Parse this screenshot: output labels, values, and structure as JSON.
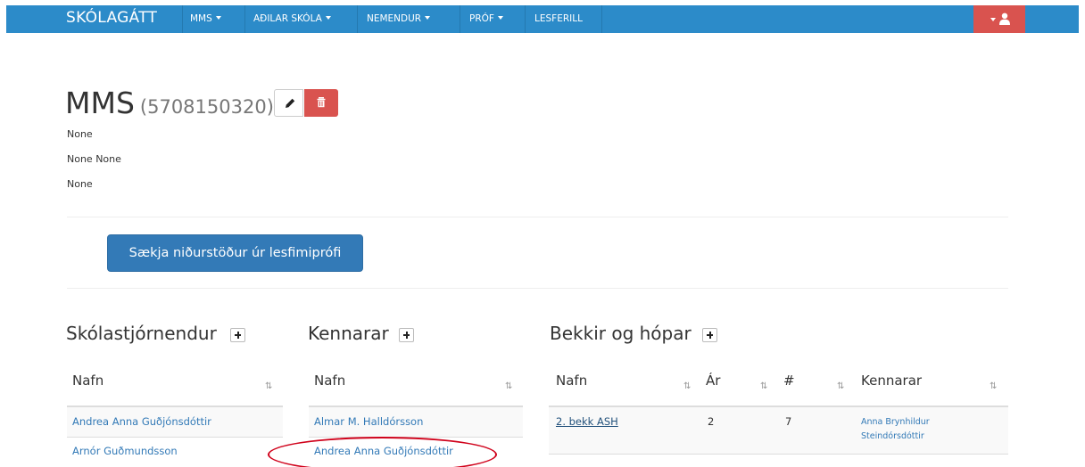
{
  "navbar": {
    "brand": "SKÓLAGÁTT",
    "items": [
      {
        "label": "MMS",
        "dropdown": true
      },
      {
        "label": "AÐILAR SKÓLA",
        "dropdown": true
      },
      {
        "label": "NEMENDUR",
        "dropdown": true
      },
      {
        "label": "PRÓF",
        "dropdown": true
      },
      {
        "label": "LESFERILL",
        "dropdown": false
      }
    ],
    "user_icon": "user-icon",
    "color": "#2c8bc9",
    "user_button_color": "#d9534f"
  },
  "header": {
    "title": "MMS",
    "id": "(5708150320)",
    "edit_icon": "pencil-icon",
    "delete_icon": "trash-icon"
  },
  "info": {
    "line1": "None",
    "line2": "None None",
    "line3": "None"
  },
  "fetch_button": "Sækja niðurstöður úr lesfimiprófi",
  "principals": {
    "title": "Skólastjórnendur",
    "header": "Nafn",
    "rows": [
      "Andrea Anna Guðjónsdóttir",
      "Arnór Guðmundsson"
    ]
  },
  "teachers": {
    "title": "Kennarar",
    "header": "Nafn",
    "rows": [
      "Almar M. Halldórsson",
      "Andrea Anna Guðjónsdóttir"
    ]
  },
  "classes": {
    "title": "Bekkir og hópar",
    "headers": {
      "name": "Nafn",
      "year": "Ár",
      "count": "#",
      "teachers": "Kennarar"
    },
    "rows": [
      {
        "name": "2. bekk ASH",
        "year": "2",
        "count": "7",
        "teachers": "Anna Brynhildur Steindórsdóttir"
      }
    ]
  },
  "accent_colors": {
    "primary": "#337ab7",
    "danger": "#d9534f",
    "annotation": "#d0021b"
  }
}
